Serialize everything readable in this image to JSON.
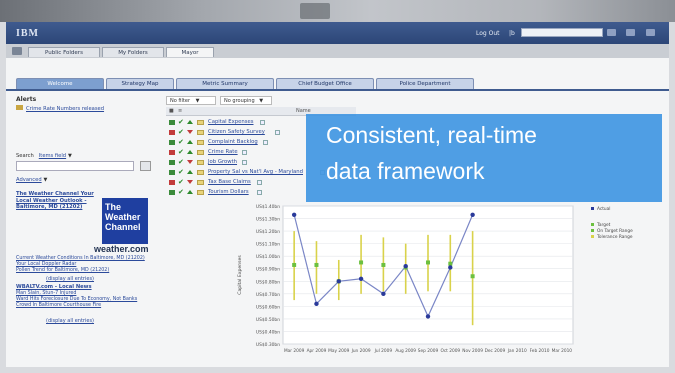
{
  "header": {
    "brand": "IBM",
    "logout": "Log Out",
    "search_label": "|b"
  },
  "folders": [
    "Public Folders",
    "My Folders",
    "Mayor"
  ],
  "tabs": [
    "Welcome",
    "Strategy Map",
    "Metric Summary",
    "Chief Budget Office",
    "Police Department"
  ],
  "left": {
    "title": "Alerts",
    "alert_link": "Crime Rate Numbers released",
    "search_label": "Search",
    "search_scope": "Items field",
    "advanced": "Advanced",
    "news1_title": "The Weather Channel Your Local Weather Outlook - Baltimore, MD (21202)",
    "weather_logo": "The Weather Channel",
    "weather_url": "weather.com",
    "news1_links": [
      "Current Weather Conditions In Baltimore, MD (21202)",
      "Your Local Doppler Radar",
      "Pollen Trend for Baltimore, MD (21202)"
    ],
    "display_all": "(display all entries)",
    "news2_title": "WBALTV.com - Local News",
    "news2_links": [
      "Man Slain, Stun-7 Injured",
      "Ward Hits Foreclosure Due To Economy, Not Banks",
      "Crowd In Baltimore Courthouse Fire"
    ]
  },
  "scorecard": {
    "filter": "No filter",
    "grouping": "No grouping",
    "col_name": "Name",
    "rows": [
      {
        "name": "Capital Expenses",
        "flag": "#3b8b3b",
        "arrow": "up"
      },
      {
        "name": "Citizen Safety Survey",
        "flag": "#c23b3b",
        "arrow": "down"
      },
      {
        "name": "Complaint Backlog",
        "flag": "#3b8b3b",
        "arrow": "up"
      },
      {
        "name": "Crime Rate",
        "flag": "#c23b3b",
        "arrow": "up"
      },
      {
        "name": "Job Growth",
        "flag": "#3b8b3b",
        "arrow": "down"
      },
      {
        "name": "Property Sal vs Nat'l Avg - Maryland",
        "flag": "#3b8b3b",
        "arrow": "up"
      },
      {
        "name": "Tax Base Claims",
        "flag": "#c23b3b",
        "arrow": "down"
      },
      {
        "name": "Tourism Dollars",
        "flag": "#3b8b3b",
        "arrow": "up"
      }
    ]
  },
  "overlay": {
    "line1": "Consistent, real-time",
    "line2": "data framework"
  },
  "chart_data": {
    "type": "line",
    "ylabel": "Capital Expenses",
    "y_ticks": [
      "US$1.40bn",
      "US$1.30bn",
      "US$1.20bn",
      "US$1.10bn",
      "US$1.00bn",
      "US$0.90bn",
      "US$0.80bn",
      "US$0.70bn",
      "US$0.60bn",
      "US$0.50bn",
      "US$0.40bn",
      "US$0.30bn"
    ],
    "categories": [
      "Mar 2009",
      "Apr 2009",
      "May 2009",
      "Jun 2009",
      "Jul 2009",
      "Aug 2009",
      "Sep 2009",
      "Oct 2009",
      "Nov 2009",
      "Dec 2009",
      "Jan 2010",
      "Feb 2010",
      "Mar 2010"
    ],
    "ylim": [
      0.3,
      1.4
    ],
    "legend": [
      "Actual",
      "Target",
      "On Target Range",
      "Tolerance Range"
    ],
    "colors": {
      "actual": "#2a3a9a",
      "target": "#6cc040",
      "range": "#d9d24a"
    },
    "series": [
      {
        "name": "Actual",
        "values": [
          1.33,
          0.62,
          0.8,
          0.82,
          0.7,
          0.92,
          0.52,
          0.91,
          1.33
        ]
      },
      {
        "name": "Target",
        "values": [
          0.93,
          0.93,
          0.8,
          0.95,
          0.93,
          0.91,
          0.95,
          0.94,
          0.84
        ]
      }
    ],
    "ranges": [
      [
        0.65,
        1.2
      ],
      [
        0.7,
        1.12
      ],
      [
        0.65,
        0.97
      ],
      [
        0.7,
        1.17
      ],
      [
        0.72,
        1.15
      ],
      [
        0.7,
        1.1
      ],
      [
        0.72,
        1.17
      ],
      [
        0.72,
        1.17
      ],
      [
        0.45,
        1.2
      ]
    ]
  }
}
